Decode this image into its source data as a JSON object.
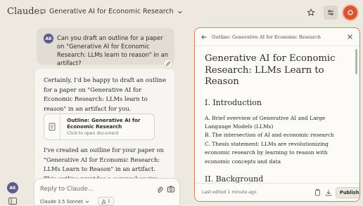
{
  "app": {
    "brand": "Claude",
    "chat_title": "Generative AI for Economic Research"
  },
  "colors": {
    "accent": "#d9542f",
    "panel_border": "#de7c62",
    "user_avatar": "#5c5a8f"
  },
  "conversation": {
    "user_initials": "AK",
    "user_message": "Can you draft an outline for a paper on \"Generative AI for Economic Research: LLMs learn to reason\" in an artifact?",
    "assistant_intro": "Certainly, I'd be happy to draft an outline for a paper on \"Generative AI for Economic Research: LLMs learn to reason\" in an artifact for you.",
    "artifact_card": {
      "title": "Outline: Generative AI for Economic Research",
      "subtitle": "Click to open document"
    },
    "assistant_followup": "I've created an outline for your paper on \"Generative AI for Economic Research: LLMs Learn to Reason\" in an artifact. This outline provides a comprehensive"
  },
  "composer": {
    "placeholder": "Reply to Claude...",
    "model": "Claude 3.5 Sonnet",
    "style_count": "1"
  },
  "artifact_panel": {
    "header_title": "Outline: Generative AI for Economic Research",
    "doc_title": "Generative AI for Economic Research: LLMs Learn to Reason",
    "section1": "I. Introduction",
    "items": [
      "A. Brief overview of Generative AI and Large Language Models (LLMs)",
      "B. The intersection of AI and economic research",
      "C. Thesis statement: LLMs are revolutionizing economic research by learning to reason with economic concepts and data"
    ],
    "section2": "II. Background",
    "footer_status": "Last edited 1 minute ago",
    "publish_label": "Publish"
  }
}
